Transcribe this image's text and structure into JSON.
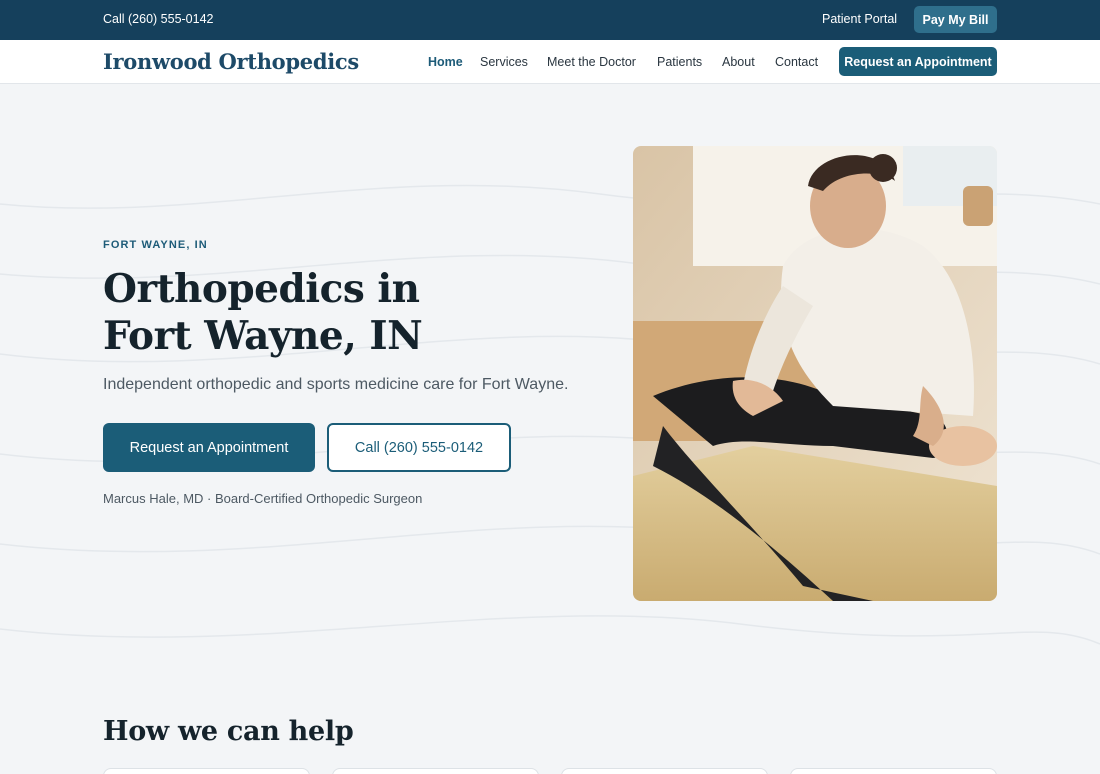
{
  "topbar": {
    "call_text": "Call (260) 555-0142",
    "patient_portal": "Patient Portal",
    "pay_bill": "Pay My Bill"
  },
  "nav": {
    "brand": "Ironwood Orthopedics",
    "links": [
      "Home",
      "Services",
      "Meet the Doctor",
      "Patients",
      "About",
      "Contact"
    ],
    "active": "Home",
    "cta": "Request an Appointment"
  },
  "hero": {
    "eyebrow": "FORT WAYNE, IN",
    "title_line1": "Orthopedics in",
    "title_line2": "Fort Wayne, IN",
    "subtitle": "Independent orthopedic and sports medicine care for Fort Wayne.",
    "primary_button": "Request an Appointment",
    "secondary_button": "Call (260) 555-0142",
    "doctor_line": "Marcus Hale, MD · Board-Certified Orthopedic Surgeon"
  },
  "section": {
    "title": "How we can help"
  },
  "colors": {
    "topbar_bg": "#15405c",
    "accent": "#1b5d78",
    "page_bg": "#f3f5f7"
  }
}
